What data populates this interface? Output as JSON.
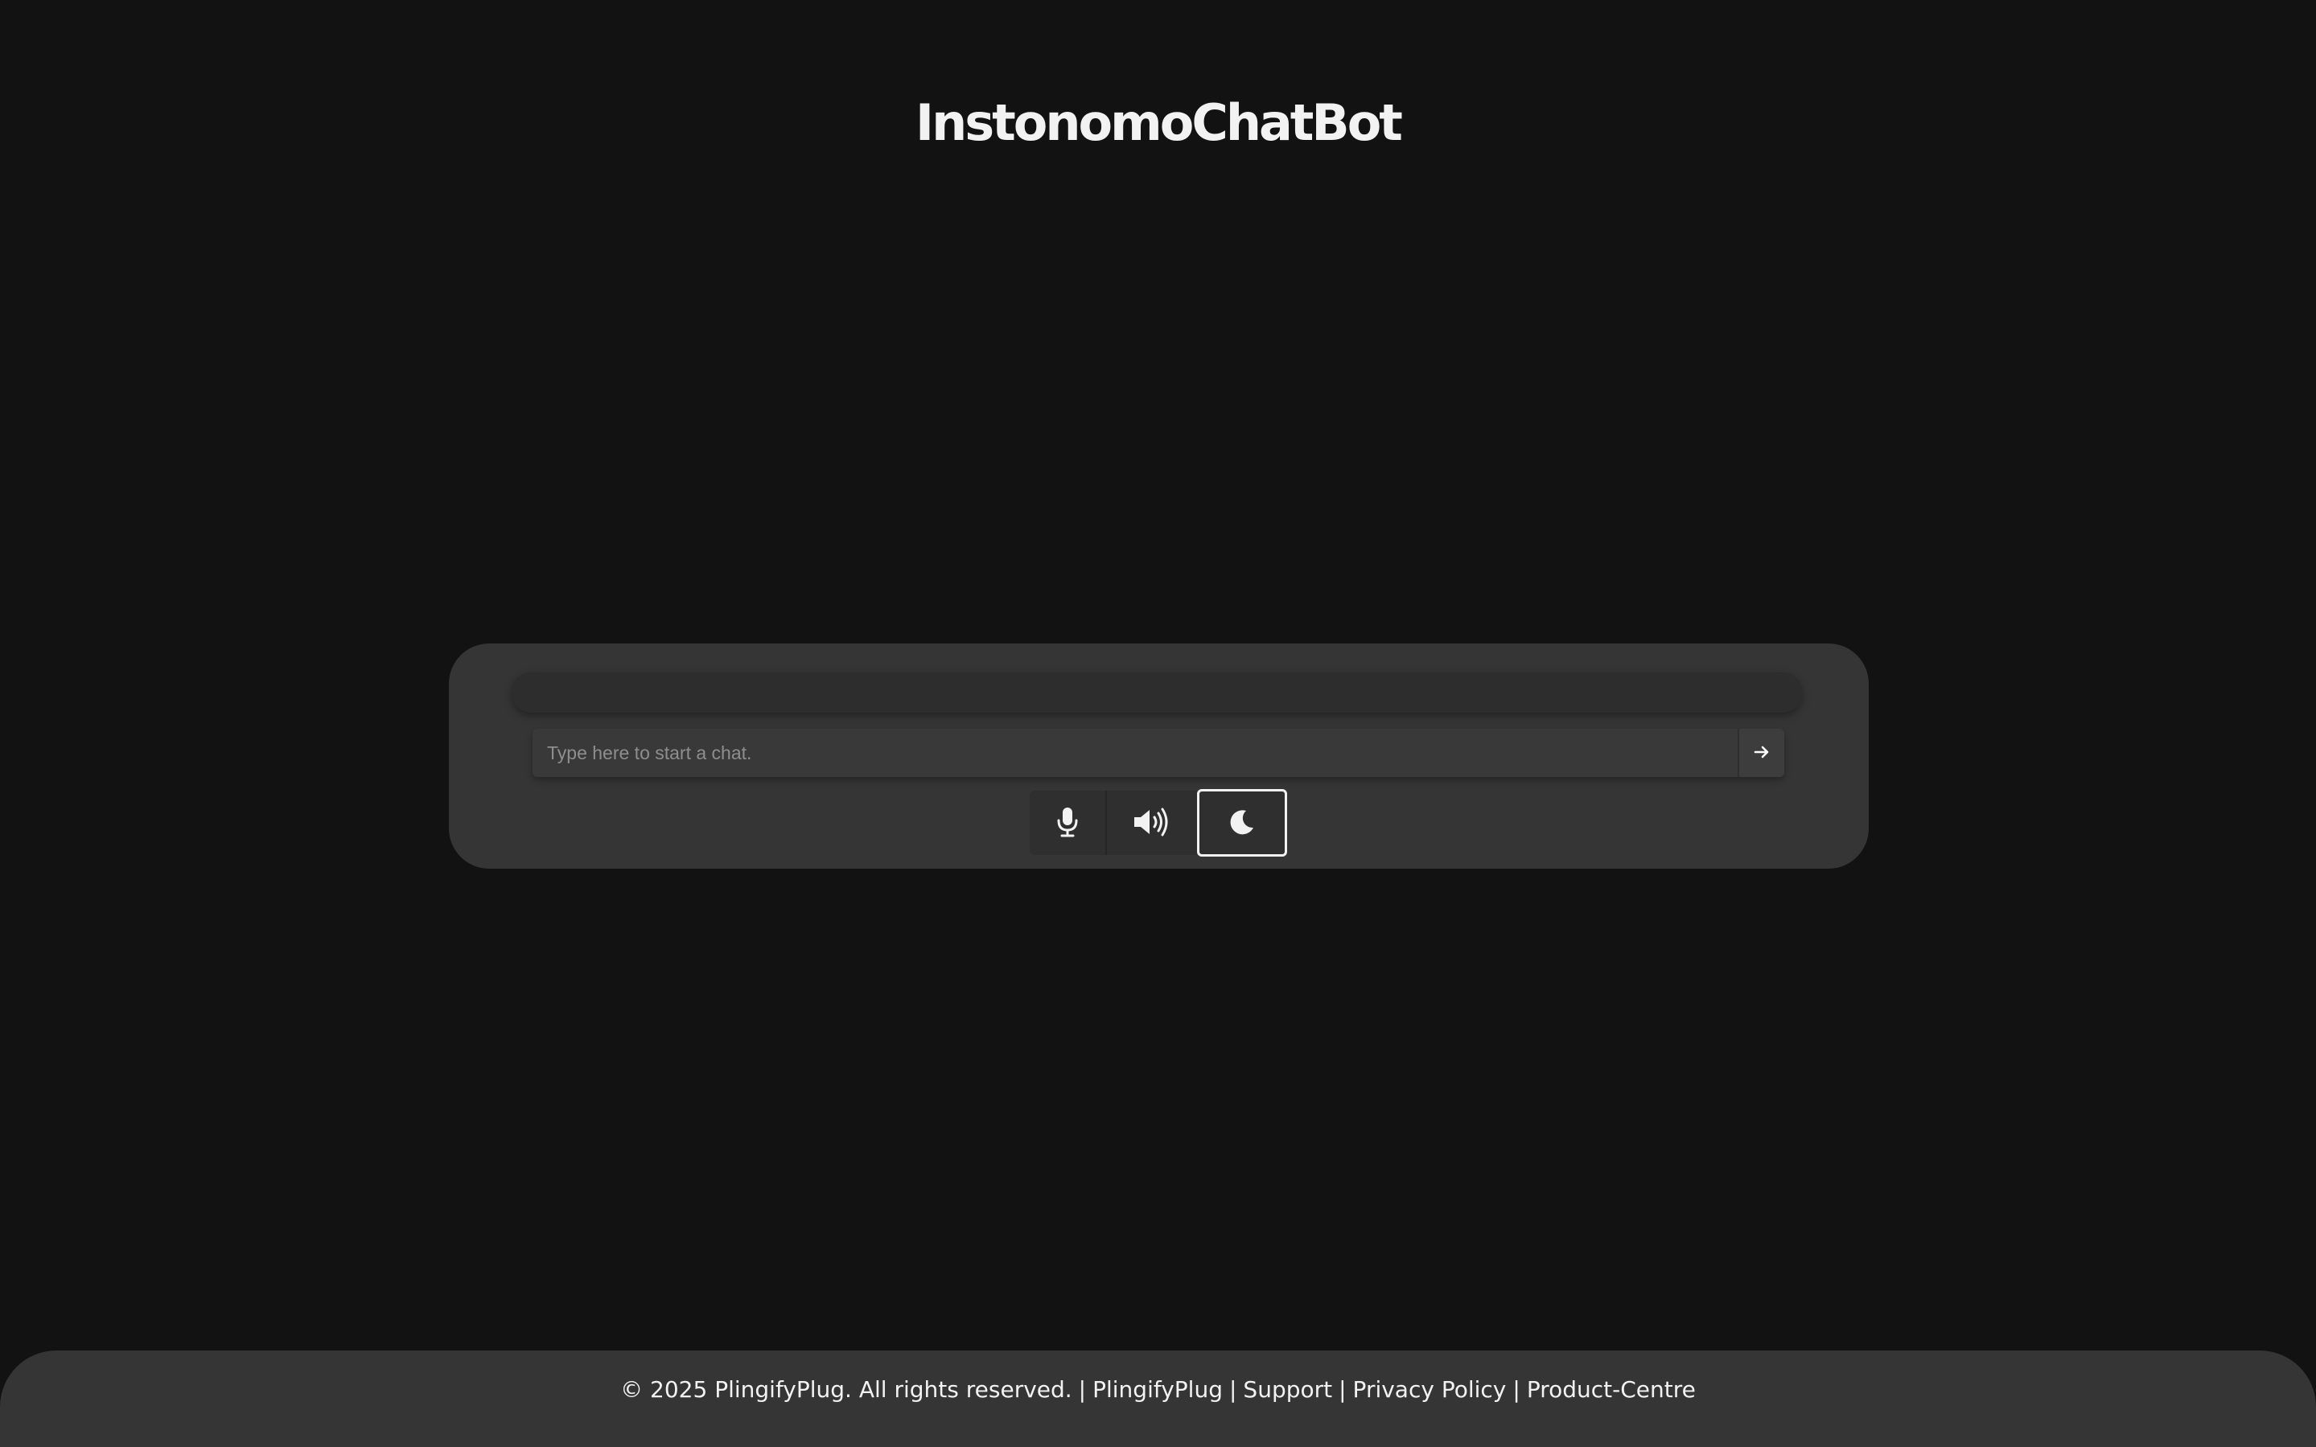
{
  "header": {
    "logo_text": "InstonomoChatBot"
  },
  "chat": {
    "input_placeholder": "Type here to start a chat.",
    "input_value": "",
    "send_icon": "arrow-right-icon",
    "controls": [
      {
        "name": "microphone",
        "icon": "microphone-icon"
      },
      {
        "name": "speaker",
        "icon": "speaker-icon"
      },
      {
        "name": "theme-toggle",
        "icon": "moon-icon"
      }
    ]
  },
  "footer": {
    "copyright": "© 2025 PlingifyPlug. All rights reserved.",
    "separator": "|",
    "links": {
      "plingifyplug": "PlingifyPlug",
      "support": "Support",
      "privacy": "Privacy Policy",
      "product_centre": "Product-Centre"
    }
  },
  "colors": {
    "background": "#121212",
    "panel": "#353535",
    "text": "#f2f2f2",
    "placeholder": "#8e8e8e"
  }
}
